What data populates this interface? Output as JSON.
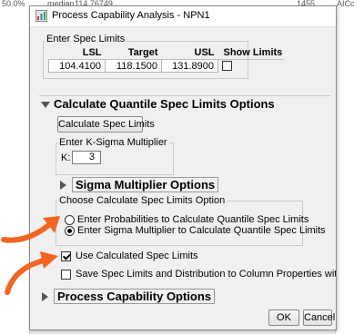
{
  "background": {
    "strip_items": [
      "50.0%",
      "median",
      "114.76749",
      "1455",
      "AICc"
    ]
  },
  "dialog": {
    "title": "Process Capability Analysis - NPN1",
    "spec_group": {
      "caption": "Enter Spec Limits",
      "headers": [
        "LSL",
        "Target",
        "USL",
        "Show Limits"
      ],
      "values": [
        "104.4100",
        "118.1500",
        "131.8900"
      ],
      "show_limits_checked": false
    },
    "quantile_section": {
      "title": "Calculate Quantile Spec Limits Options",
      "calc_button_label": "Calculate Spec Limits",
      "k_sigma": {
        "caption": "Enter K-Sigma Multiplier",
        "label": "K:",
        "value": "3"
      }
    },
    "sigma_section": {
      "title": "Sigma Multiplier Options"
    },
    "option_group": {
      "caption": "Choose Calculate Spec Limits Option",
      "options": [
        "Enter Probabilities to Calculate Quantile Spec Limits",
        "Enter Sigma Multiplier to Calculate Quantile Spec Limits"
      ],
      "selected_index": 1
    },
    "use_calculated": {
      "label": "Use Calculated Spec Limits",
      "checked": true
    },
    "save_spec": {
      "label": "Save Spec Limits and Distribution to Column Properties without Report",
      "checked": false
    },
    "capability_section": {
      "title": "Process Capability Options"
    },
    "buttons": {
      "ok": "OK",
      "cancel": "Cancel"
    }
  },
  "colors": {
    "annotation_arrow": "#f26522",
    "dialog_bg": "#f0f0f0"
  },
  "icons": [
    "app-icon",
    "collapse-triangle-icon",
    "expand-triangle-icon"
  ]
}
